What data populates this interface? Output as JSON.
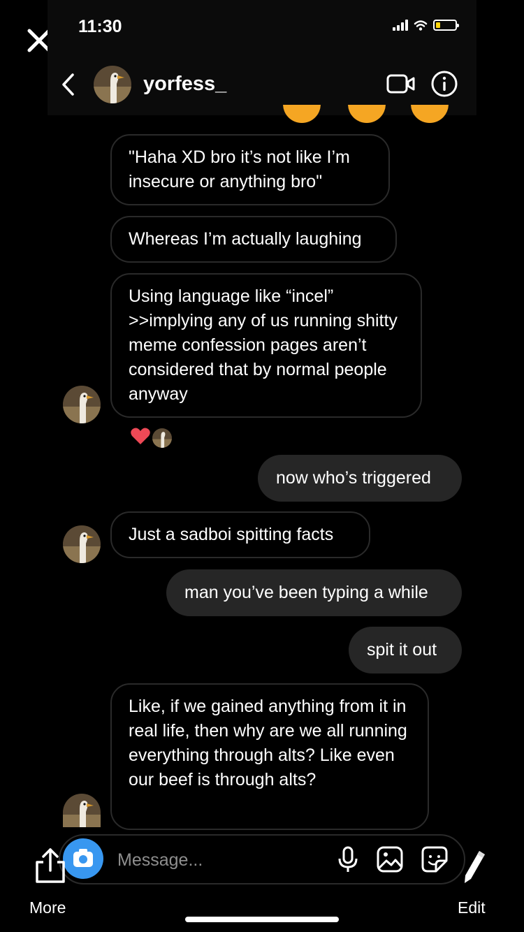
{
  "status_bar": {
    "time": "11:30"
  },
  "header": {
    "username": "yorfess_"
  },
  "messages": [
    {
      "side": "in",
      "text": "\"Haha XD bro it’s not like I’m insecure or anything bro\""
    },
    {
      "side": "in",
      "text": "Whereas I’m actually laughing"
    },
    {
      "side": "in",
      "text": "Using language like “incel” >>implying any of us running shitty meme confession pages aren’t considered that by normal people anyway",
      "reactions": [
        "❤️"
      ]
    },
    {
      "side": "out",
      "text": "now who’s triggered"
    },
    {
      "side": "in",
      "text": "Just a sadboi spitting facts"
    },
    {
      "side": "out",
      "text": "man you’ve been typing a while"
    },
    {
      "side": "out",
      "text": "spit it out"
    },
    {
      "side": "in",
      "text": "Like, if we gained anything from it in real life, then why are we all running everything through alts? Like even our beef is through alts?"
    }
  ],
  "composer": {
    "placeholder": "Message..."
  },
  "bottom_actions": {
    "more_label": "More",
    "edit_label": "Edit"
  },
  "colors": {
    "accent": "#3897f0",
    "reaction": "#ed4956",
    "bubble_out": "#262626"
  }
}
